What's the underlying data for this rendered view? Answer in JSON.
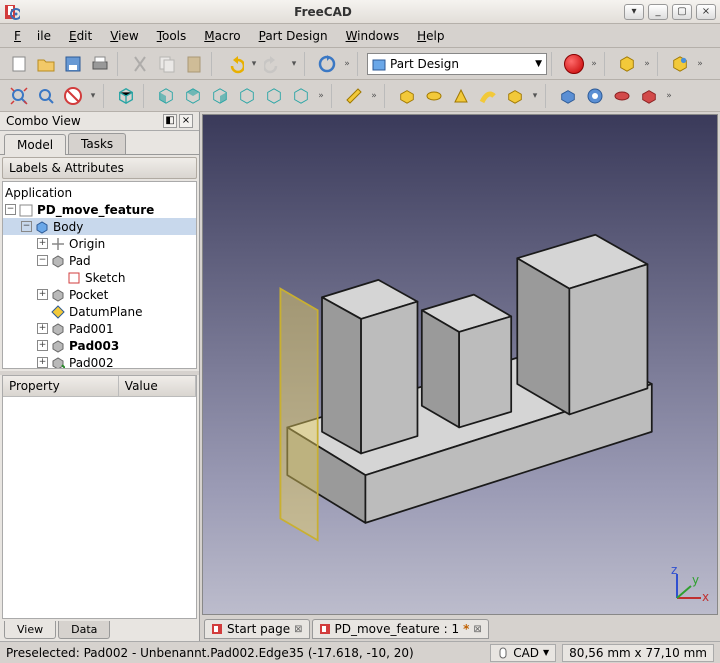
{
  "titlebar": {
    "title": "FreeCAD"
  },
  "menu": {
    "file": "File",
    "edit": "Edit",
    "view": "View",
    "tools": "Tools",
    "macro": "Macro",
    "partdesign": "Part Design",
    "windows": "Windows",
    "help": "Help"
  },
  "workbench": {
    "selected": "Part Design"
  },
  "combo": {
    "title": "Combo View",
    "tab_model": "Model",
    "tab_tasks": "Tasks",
    "labels_header": "Labels & Attributes",
    "prop_col1": "Property",
    "prop_col2": "Value",
    "btab_view": "View",
    "btab_data": "Data"
  },
  "tree": {
    "root": "Application",
    "doc": "PD_move_feature",
    "body": "Body",
    "origin": "Origin",
    "pad": "Pad",
    "sketch": "Sketch",
    "pocket": "Pocket",
    "datum": "DatumPlane",
    "pad001": "Pad001",
    "pad003": "Pad003",
    "pad002": "Pad002"
  },
  "doctabs": {
    "start": "Start page",
    "doc1": "PD_move_feature : 1"
  },
  "status": {
    "preselected": "Preselected: Pad002 - Unbenannt.Pad002.Edge35 (-17.618, -10, 20)",
    "cad": "CAD",
    "dims": "80,56 mm x 77,10 mm"
  }
}
